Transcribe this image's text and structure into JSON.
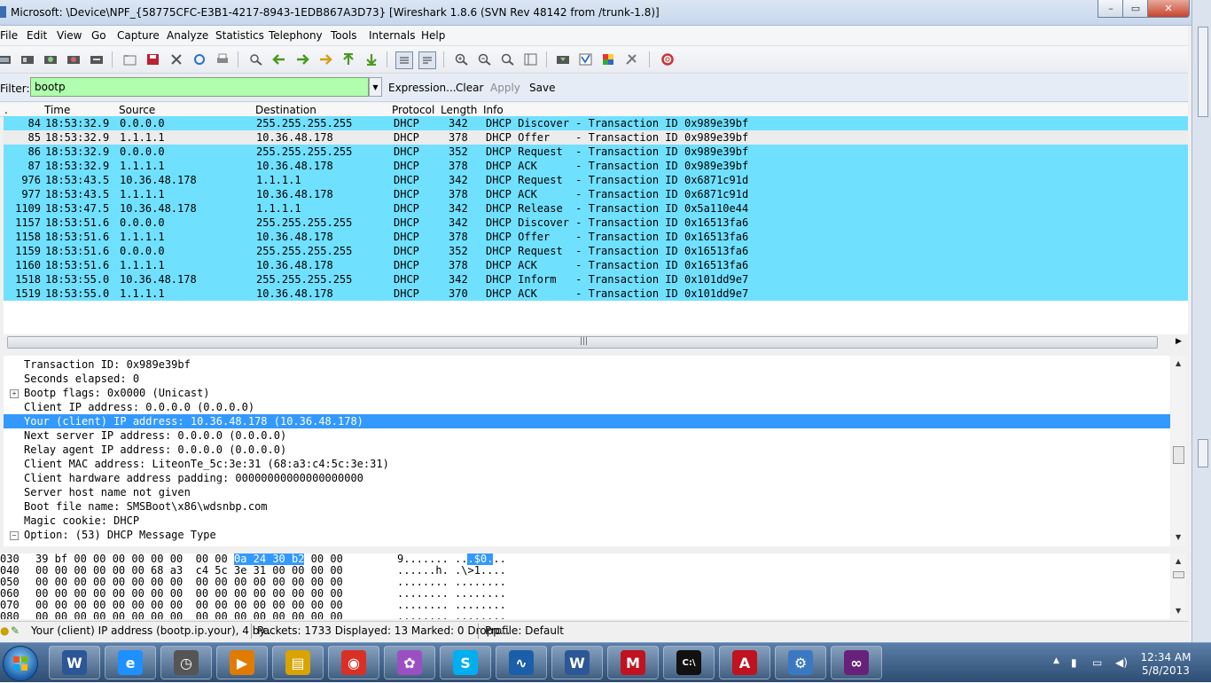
{
  "window": {
    "title": "Microsoft: \\Device\\NPF_{58775CFC-E3B1-4217-8943-1EDB867A3D73}   [Wireshark 1.8.6  (SVN Rev 48142 from /trunk-1.8)]",
    "minimize": "–",
    "maximize": "▭",
    "close": "✕"
  },
  "menu": [
    "File",
    "Edit",
    "View",
    "Go",
    "Capture",
    "Analyze",
    "Statistics",
    "Telephony",
    "Tools",
    "Internals",
    "Help"
  ],
  "toolbar": {
    "icons": [
      "interface-list-icon",
      "capture-options-icon",
      "start-capture-icon",
      "stop-capture-icon",
      "restart-capture-icon",
      "open-file-icon",
      "save-file-icon",
      "close-file-icon",
      "reload-icon",
      "print-icon",
      "find-packet-icon",
      "go-back-icon",
      "go-forward-icon",
      "go-to-packet-icon",
      "go-first-icon",
      "go-last-icon",
      "colorize-icon",
      "autoscroll-icon",
      "zoom-in-icon",
      "zoom-out-icon",
      "zoom-normal-icon",
      "resize-columns-icon",
      "capture-filters-icon",
      "display-filters-icon",
      "coloring-rules-icon",
      "preferences-icon",
      "help-icon"
    ]
  },
  "filter": {
    "label": "Filter:",
    "value": "bootp",
    "links": [
      "Expression...",
      "Clear",
      "Apply",
      "Save"
    ]
  },
  "packet_list": {
    "columns": [
      ".",
      "Time",
      "Source",
      "Destination",
      "Protocol",
      "Length",
      "Info"
    ],
    "rows": [
      {
        "no": "84",
        "time": "18:53:32.9",
        "src": "0.0.0.0",
        "dst": "255.255.255.255",
        "proto": "DHCP",
        "len": "342",
        "info": "DHCP Discover - Transaction ID 0x989e39bf"
      },
      {
        "no": "85",
        "time": "18:53:32.9",
        "src": "1.1.1.1",
        "dst": "10.36.48.178",
        "proto": "DHCP",
        "len": "378",
        "info": "DHCP Offer    - Transaction ID 0x989e39bf"
      },
      {
        "no": "86",
        "time": "18:53:32.9",
        "src": "0.0.0.0",
        "dst": "255.255.255.255",
        "proto": "DHCP",
        "len": "352",
        "info": "DHCP Request  - Transaction ID 0x989e39bf"
      },
      {
        "no": "87",
        "time": "18:53:32.9",
        "src": "1.1.1.1",
        "dst": "10.36.48.178",
        "proto": "DHCP",
        "len": "378",
        "info": "DHCP ACK      - Transaction ID 0x989e39bf"
      },
      {
        "no": "976",
        "time": "18:53:43.5",
        "src": "10.36.48.178",
        "dst": "1.1.1.1",
        "proto": "DHCP",
        "len": "342",
        "info": "DHCP Request  - Transaction ID 0x6871c91d"
      },
      {
        "no": "977",
        "time": "18:53:43.5",
        "src": "1.1.1.1",
        "dst": "10.36.48.178",
        "proto": "DHCP",
        "len": "378",
        "info": "DHCP ACK      - Transaction ID 0x6871c91d"
      },
      {
        "no": "1109",
        "time": "18:53:47.5",
        "src": "10.36.48.178",
        "dst": "1.1.1.1",
        "proto": "DHCP",
        "len": "342",
        "info": "DHCP Release  - Transaction ID 0x5a110e44"
      },
      {
        "no": "1157",
        "time": "18:53:51.6",
        "src": "0.0.0.0",
        "dst": "255.255.255.255",
        "proto": "DHCP",
        "len": "342",
        "info": "DHCP Discover - Transaction ID 0x16513fa6"
      },
      {
        "no": "1158",
        "time": "18:53:51.6",
        "src": "1.1.1.1",
        "dst": "10.36.48.178",
        "proto": "DHCP",
        "len": "378",
        "info": "DHCP Offer    - Transaction ID 0x16513fa6"
      },
      {
        "no": "1159",
        "time": "18:53:51.6",
        "src": "0.0.0.0",
        "dst": "255.255.255.255",
        "proto": "DHCP",
        "len": "352",
        "info": "DHCP Request  - Transaction ID 0x16513fa6"
      },
      {
        "no": "1160",
        "time": "18:53:51.6",
        "src": "1.1.1.1",
        "dst": "10.36.48.178",
        "proto": "DHCP",
        "len": "378",
        "info": "DHCP ACK      - Transaction ID 0x16513fa6"
      },
      {
        "no": "1518",
        "time": "18:53:55.0",
        "src": "10.36.48.178",
        "dst": "255.255.255.255",
        "proto": "DHCP",
        "len": "342",
        "info": "DHCP Inform   - Transaction ID 0x101dd9e7"
      },
      {
        "no": "1519",
        "time": "18:53:55.0",
        "src": "1.1.1.1",
        "dst": "10.36.48.178",
        "proto": "DHCP",
        "len": "370",
        "info": "DHCP ACK      - Transaction ID 0x101dd9e7"
      }
    ],
    "selected_index": 1,
    "row_color": "#70e0ff",
    "scroll_grip": "|||"
  },
  "details": {
    "lines": [
      {
        "text": "Transaction ID: 0x989e39bf",
        "expander": ""
      },
      {
        "text": "Seconds elapsed: 0",
        "expander": ""
      },
      {
        "text": "Bootp flags: 0x0000 (Unicast)",
        "expander": "+"
      },
      {
        "text": "Client IP address: 0.0.0.0 (0.0.0.0)",
        "expander": ""
      },
      {
        "text": "Your (client) IP address: 10.36.48.178 (10.36.48.178)",
        "expander": "",
        "highlight": true
      },
      {
        "text": "Next server IP address: 0.0.0.0 (0.0.0.0)",
        "expander": ""
      },
      {
        "text": "Relay agent IP address: 0.0.0.0 (0.0.0.0)",
        "expander": ""
      },
      {
        "text": "Client MAC address: LiteonTe_5c:3e:31 (68:a3:c4:5c:3e:31)",
        "expander": ""
      },
      {
        "text": "Client hardware address padding: 00000000000000000000",
        "expander": ""
      },
      {
        "text": "Server host name not given",
        "expander": ""
      },
      {
        "text": "Boot file name: SMSBoot\\x86\\wdsnbp.com",
        "expander": ""
      },
      {
        "text": "Magic cookie: DHCP",
        "expander": ""
      },
      {
        "text": "Option: (53) DHCP Message Type",
        "expander": "−"
      }
    ]
  },
  "hex": {
    "rows": [
      {
        "offset": "030",
        "pre": "39 bf 00 00 00 00 00 00  00 00 ",
        "sel": "0a 24 30 b2",
        "post": " 00 00",
        "ascii_pre": "9....... ..",
        "ascii_sel": ".$0.",
        "ascii_post": ".."
      },
      {
        "offset": "040",
        "pre": "00 00 00 00 00 00 68 a3  c4 5c 3e 31 00 00 00 00",
        "sel": "",
        "post": "",
        "ascii_pre": "......h. .\\>1....",
        "ascii_sel": "",
        "ascii_post": ""
      },
      {
        "offset": "050",
        "pre": "00 00 00 00 00 00 00 00  00 00 00 00 00 00 00 00",
        "sel": "",
        "post": "",
        "ascii_pre": "........ ........",
        "ascii_sel": "",
        "ascii_post": ""
      },
      {
        "offset": "060",
        "pre": "00 00 00 00 00 00 00 00  00 00 00 00 00 00 00 00",
        "sel": "",
        "post": "",
        "ascii_pre": "........ ........",
        "ascii_sel": "",
        "ascii_post": ""
      },
      {
        "offset": "070",
        "pre": "00 00 00 00 00 00 00 00  00 00 00 00 00 00 00 00",
        "sel": "",
        "post": "",
        "ascii_pre": "........ ........",
        "ascii_sel": "",
        "ascii_post": ""
      },
      {
        "offset": "080",
        "pre": "00 00 00 00 00 00 00 00  00 00 00 00 00 00 00 00",
        "sel": "",
        "post": "",
        "ascii_pre": "........ ........",
        "ascii_sel": "",
        "ascii_post": ""
      }
    ]
  },
  "status": {
    "field": "Your (client) IP address (bootp.ip.your), 4 by...",
    "packets": "Packets: 1733 Displayed: 13 Marked: 0 Dropp...",
    "profile": "Profile: Default"
  },
  "taskbar": {
    "items": [
      {
        "name": "word-icon",
        "glyph": "W",
        "color": "#2b5797"
      },
      {
        "name": "internet-explorer-icon",
        "glyph": "e",
        "color": "#1e90ff"
      },
      {
        "name": "clock-app-icon",
        "glyph": "◷",
        "color": "#555"
      },
      {
        "name": "media-player-icon",
        "glyph": "▶",
        "color": "#e07b00"
      },
      {
        "name": "file-explorer-icon",
        "glyph": "▤",
        "color": "#d9a400"
      },
      {
        "name": "chrome-icon",
        "glyph": "◉",
        "color": "#d93025"
      },
      {
        "name": "messenger-icon",
        "glyph": "✿",
        "color": "#9c4fc2"
      },
      {
        "name": "skype-icon",
        "glyph": "S",
        "color": "#00aff0"
      },
      {
        "name": "wireshark-icon",
        "glyph": "∿",
        "color": "#1a5fa8"
      },
      {
        "name": "word-doc-icon",
        "glyph": "W",
        "color": "#2b5797"
      },
      {
        "name": "mcafee-icon",
        "glyph": "M",
        "color": "#c1121f"
      },
      {
        "name": "command-prompt-icon",
        "glyph": "C:\\",
        "color": "#111"
      },
      {
        "name": "acrobat-icon",
        "glyph": "A",
        "color": "#c1121f"
      },
      {
        "name": "control-panel-icon",
        "glyph": "⚙",
        "color": "#3a78c2"
      },
      {
        "name": "visual-studio-icon",
        "glyph": "∞",
        "color": "#68217a"
      }
    ],
    "time": "12:34 AM",
    "date": "5/8/2013"
  }
}
